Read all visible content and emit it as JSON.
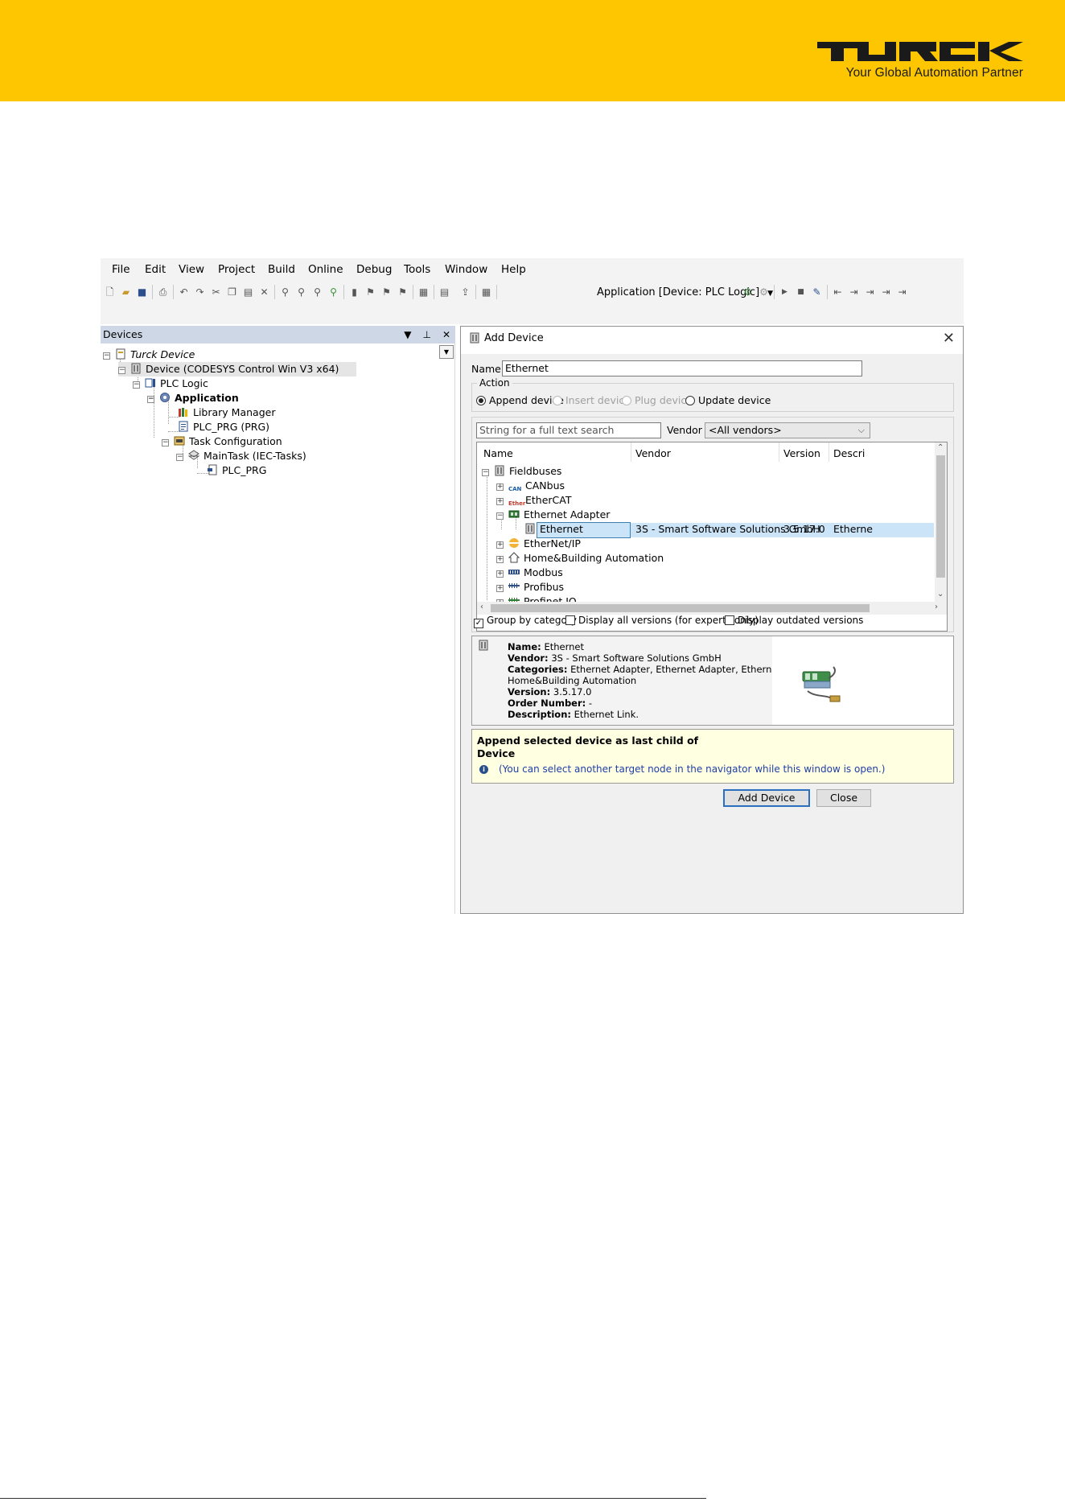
{
  "brand": {
    "logo_text": "TURCK",
    "tagline": "Your Global Automation Partner",
    "color": "#fdc600"
  },
  "menu": [
    "File",
    "Edit",
    "View",
    "Project",
    "Build",
    "Online",
    "Debug",
    "Tools",
    "Window",
    "Help"
  ],
  "toolbar": {
    "application_selector": "Application [Device: PLC Logic]"
  },
  "devices_panel": {
    "title": "Devices",
    "tree": [
      {
        "label": "Turck Device",
        "icon": "project-icon"
      },
      {
        "label": "Device (CODESYS Control Win V3 x64)",
        "icon": "device-icon"
      },
      {
        "label": "PLC Logic",
        "icon": "plc-logic-icon"
      },
      {
        "label": "Application",
        "icon": "application-gear-icon"
      },
      {
        "label": "Library Manager",
        "icon": "library-icon"
      },
      {
        "label": "PLC_PRG (PRG)",
        "icon": "program-icon"
      },
      {
        "label": "Task Configuration",
        "icon": "task-config-icon"
      },
      {
        "label": "MainTask (IEC-Tasks)",
        "icon": "task-icon"
      },
      {
        "label": "PLC_PRG",
        "icon": "program-call-icon"
      }
    ]
  },
  "dialog": {
    "title": "Add Device",
    "name_label": "Name",
    "name_value": "Ethernet",
    "action_label": "Action",
    "actions": [
      {
        "label": "Append device",
        "selected": true,
        "enabled": true
      },
      {
        "label": "Insert device",
        "selected": false,
        "enabled": false
      },
      {
        "label": "Plug device",
        "selected": false,
        "enabled": false
      },
      {
        "label": "Update device",
        "selected": false,
        "enabled": true
      }
    ],
    "search_placeholder": "String for a full text search",
    "vendor_label": "Vendor",
    "vendor_value": "<All vendors>",
    "columns": [
      "Name",
      "Vendor",
      "Version",
      "Descri"
    ],
    "rows": [
      {
        "name": "Fieldbuses",
        "icon": "fieldbus-icon"
      },
      {
        "name": "CANbus",
        "icon": "can-icon",
        "icon_text": "CAN"
      },
      {
        "name": "EtherCAT",
        "icon": "ethercat-icon",
        "icon_text": "Ether"
      },
      {
        "name": "Ethernet Adapter",
        "icon": "ethernet-adapter-icon"
      },
      {
        "name": "Ethernet",
        "vendor": "3S - Smart Software Solutions GmbH",
        "version": "3.5.17.0",
        "description": "Etherne",
        "selected": true
      },
      {
        "name": "EtherNet/IP",
        "icon": "ethernet-ip-icon"
      },
      {
        "name": "Home&Building Automation",
        "icon": "home-icon"
      },
      {
        "name": "Modbus",
        "icon": "modbus-icon"
      },
      {
        "name": "Profibus",
        "icon": "profibus-icon"
      },
      {
        "name": "Profinet IO",
        "icon": "profinet-icon"
      }
    ],
    "checkboxes": [
      {
        "label": "Group by category",
        "checked": true
      },
      {
        "label": "Display all versions (for experts only)",
        "checked": false
      },
      {
        "label": "Display outdated versions",
        "checked": false
      }
    ],
    "info": {
      "name_key": "Name:",
      "name_val": "Ethernet",
      "vendor_key": "Vendor:",
      "vendor_val": "3S - Smart Software Solutions GmbH",
      "categories_key": "Categories:",
      "categories_val": "Ethernet Adapter, Ethernet Adapter, Ethernet Adapter,",
      "categories_val2": "Home&Building Automation",
      "version_key": "Version:",
      "version_val": "3.5.17.0",
      "order_key": "Order Number:",
      "order_val": "-",
      "desc_key": "Description:",
      "desc_val": "Ethernet Link."
    },
    "note": {
      "line1": "Append selected device as last child of",
      "line2": "Device",
      "hint": "(You can select another target node in the navigator while this window is open.)"
    },
    "add_button": "Add Device",
    "close_button": "Close"
  }
}
